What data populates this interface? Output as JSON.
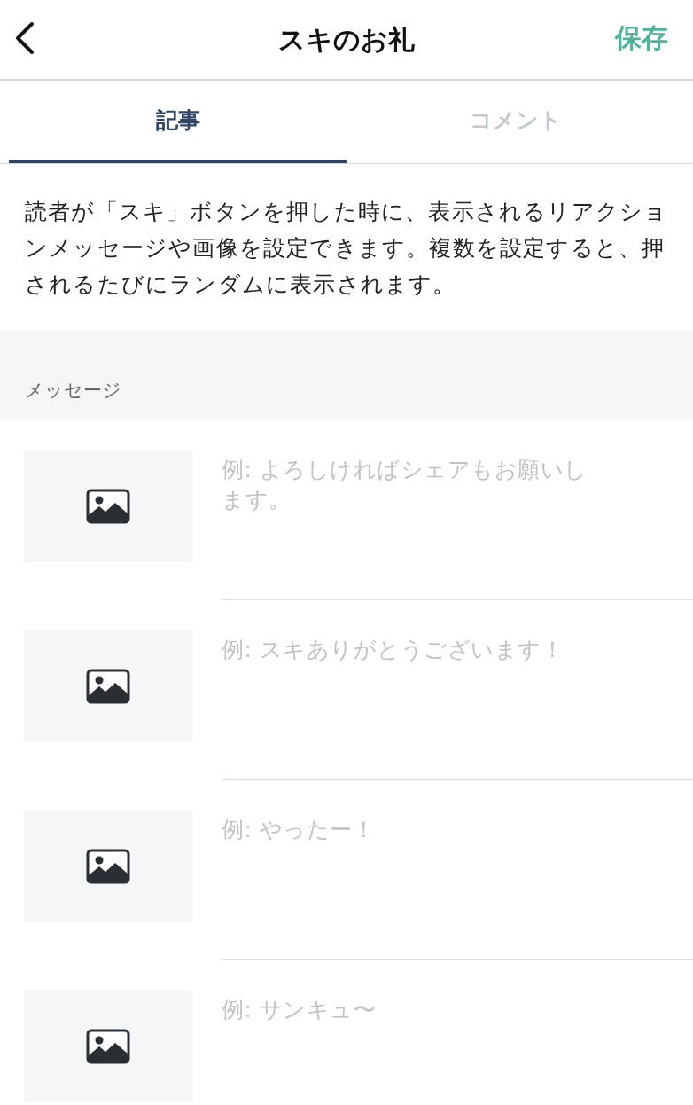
{
  "header": {
    "title": "スキのお礼",
    "save": "保存"
  },
  "tabs": [
    {
      "label": "記事",
      "selected": true
    },
    {
      "label": "コメント",
      "selected": false
    }
  ],
  "description": "読者が「スキ」ボタンを押した時に、表示されるリアクションメッセージや画像を設定できます。複数を設定すると、押されるたびにランダムに表示されます。",
  "section_label": "メッセージ",
  "messages": [
    {
      "placeholder": "例: よろしければシェアもお願いします。"
    },
    {
      "placeholder": "例: スキありがとうございます！"
    },
    {
      "placeholder": "例: やったー！"
    },
    {
      "placeholder": "例: サンキュ〜"
    }
  ]
}
